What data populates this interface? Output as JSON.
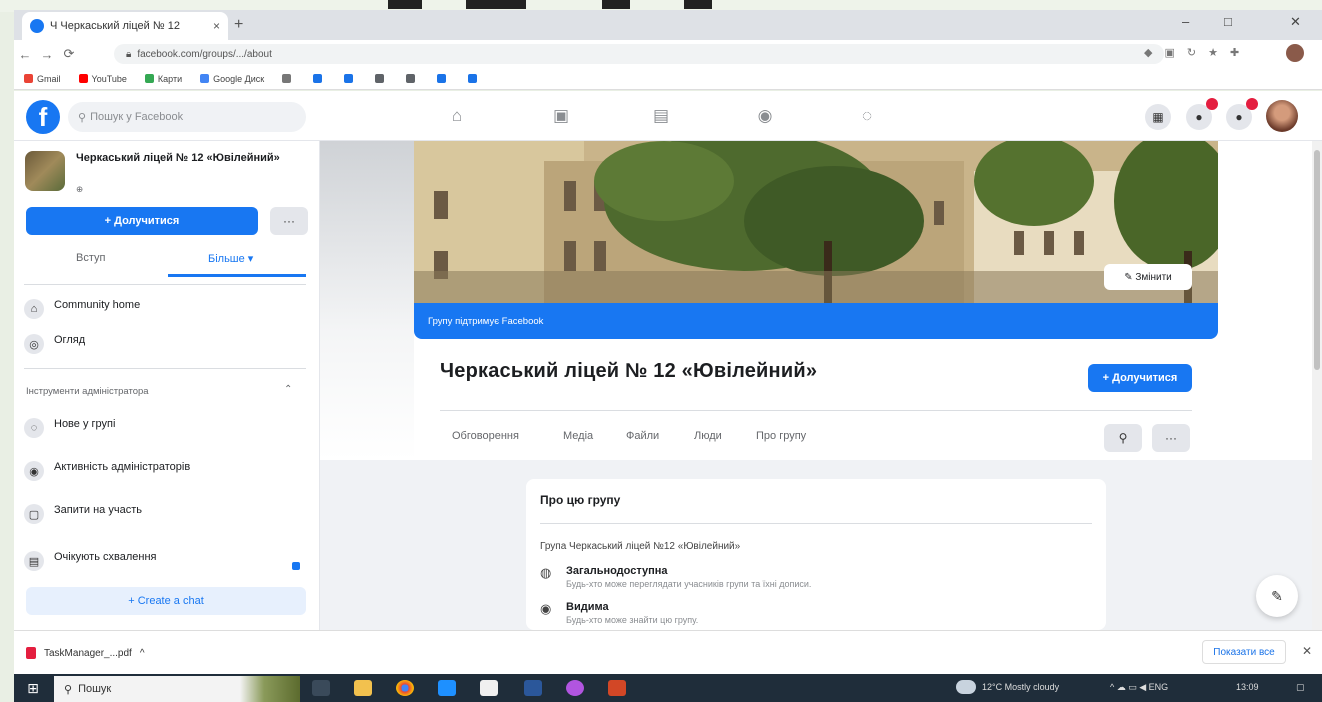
{
  "browser": {
    "tab_title": "Ч Черкаський ліцей № 12",
    "tab_close": "×",
    "new_tab": "+",
    "window_controls": [
      "–",
      "□",
      "✕"
    ],
    "url": "facebook.com/groups/.../about",
    "nav": [
      "←",
      "→",
      "⟳"
    ],
    "bookmarks": [
      {
        "label": "Gmail",
        "color": "#ea4335"
      },
      {
        "label": "YouTube",
        "color": "#ff0000"
      },
      {
        "label": "Карти",
        "color": "#34a853"
      },
      {
        "label": "Google Диск",
        "color": "#4285f4"
      },
      {
        "label": "",
        "color": "#777777"
      },
      {
        "label": "",
        "color": "#1a73e8"
      },
      {
        "label": "",
        "color": "#1a73e8"
      },
      {
        "label": "",
        "color": "#5f6368"
      },
      {
        "label": "",
        "color": "#5f6368"
      },
      {
        "label": "",
        "color": "#1a73e8"
      },
      {
        "label": "",
        "color": "#1a73e8"
      }
    ]
  },
  "fb": {
    "logo": "f",
    "search_placeholder": "Пошук у Facebook",
    "nav_icons": [
      "home-icon",
      "watch-icon",
      "marketplace-icon",
      "groups-icon",
      "gaming-icon"
    ],
    "nav_glyphs": [
      "⌂",
      "▣",
      "▤",
      "◉",
      "◌"
    ],
    "right_icons": [
      "menu-icon",
      "messenger-icon",
      "notifications-icon"
    ],
    "right_glyphs": [
      "▦",
      "●",
      "●"
    ]
  },
  "sidebar": {
    "group_name": "Черкаський ліцей № 12 «Ювілейний»",
    "join_label": "+ Долучитися",
    "more_label": "···",
    "tab_about": "Вступ",
    "tab_more": "Більше ▾",
    "items": [
      {
        "label": "Community home",
        "sub": "",
        "glyph": "⌂"
      },
      {
        "label": "Огляд",
        "sub": "",
        "glyph": "◎"
      }
    ],
    "admin_section": "Інструменти адміністратора",
    "admin_items": [
      {
        "label": "Нове у групі",
        "sub": "",
        "glyph": "◌"
      },
      {
        "label": "Активність адміністраторів",
        "sub": "",
        "glyph": "◉"
      },
      {
        "label": "Запити на участь",
        "sub": "",
        "glyph": "▢"
      },
      {
        "label": "Очікують схвалення",
        "sub": "",
        "glyph": "▤"
      }
    ],
    "create_chat": "+ Create a chat"
  },
  "main": {
    "cover_banner": "Групу підтримує Facebook",
    "edit_cover": "✎ Змінити",
    "title": "Черкаський ліцей № 12 «Ювілейний»",
    "join_label": "+ Долучитися",
    "tabs": [
      "Обговорення",
      "Медіа",
      "Файли",
      "Люди",
      "Про групу"
    ],
    "about": {
      "heading": "Про цю групу",
      "description": "Група Черкаський ліцей №12 «Ювілейний»",
      "rows": [
        {
          "title": "Загальнодоступна",
          "sub": "Будь-хто може переглядати учасників групи та їхні дописи.",
          "glyph": "◍"
        },
        {
          "title": "Видима",
          "sub": "Будь-хто може знайти цю групу.",
          "glyph": "◉"
        }
      ]
    }
  },
  "downloads": {
    "item": "TaskManager_...pdf",
    "item_menu": "^",
    "show_all": "Показати все",
    "close": "✕"
  },
  "taskbar": {
    "start": "⊞",
    "search": "Пошук",
    "weather": "12°C Mostly cloudy",
    "time": "13:09"
  }
}
